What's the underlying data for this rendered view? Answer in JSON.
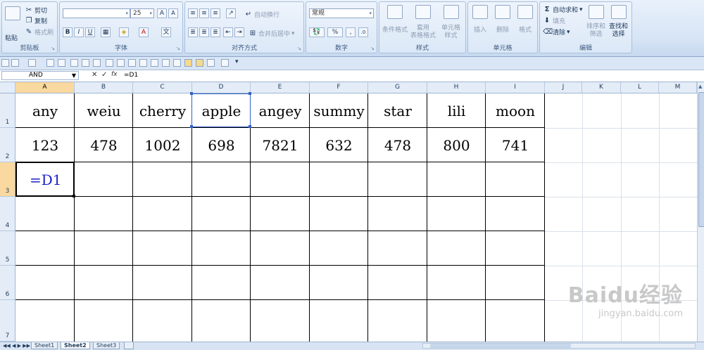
{
  "ribbon": {
    "clipboard": {
      "paste": "粘贴",
      "cut": "剪切",
      "copy": "复制",
      "format_painter": "格式刷",
      "label": "剪贴板"
    },
    "font": {
      "size": "25",
      "label": "字体"
    },
    "alignment": {
      "wrap": "自动换行",
      "merge": "合并后居中",
      "label": "对齐方式"
    },
    "number": {
      "format": "常规",
      "percent": "%",
      "label": "数字"
    },
    "styles": {
      "conditional": "条件格式",
      "table_format": "套用\n表格格式",
      "cell_style": "单元格\n样式",
      "label": "样式"
    },
    "cells": {
      "insert": "插入",
      "delete": "删除",
      "format": "格式",
      "label": "单元格"
    },
    "editing": {
      "autosum": "自动求和",
      "fill": "填充",
      "clear": "清除",
      "sort": "排序和\n筛选",
      "find": "查找和\n选择",
      "label": "编辑"
    }
  },
  "formula_bar": {
    "name_box": "AND",
    "fx": "fx",
    "formula": "=D1"
  },
  "columns": [
    "A",
    "B",
    "C",
    "D",
    "E",
    "F",
    "G",
    "H",
    "I",
    "J",
    "K",
    "L",
    "M"
  ],
  "rows": [
    "1",
    "2",
    "3",
    "4",
    "5",
    "6",
    "7"
  ],
  "cells": {
    "row1": [
      "any",
      "weiu",
      "cherry",
      "apple",
      "angey",
      "summy",
      "star",
      "lili",
      "moon"
    ],
    "row2": [
      "123",
      "478",
      "1002",
      "698",
      "7821",
      "632",
      "478",
      "800",
      "741"
    ],
    "A3": "=D1"
  },
  "sheet_tabs": [
    "Sheet1",
    "Sheet2",
    "Sheet3"
  ],
  "active_sheet": "Sheet2",
  "watermark": {
    "brand": "Baidu经验",
    "url": "jingyan.baidu.com"
  },
  "colors": {
    "selection": "#f9d99f",
    "formula_blue": "#1c1cc8",
    "ribbon": "#d6e4f5"
  }
}
